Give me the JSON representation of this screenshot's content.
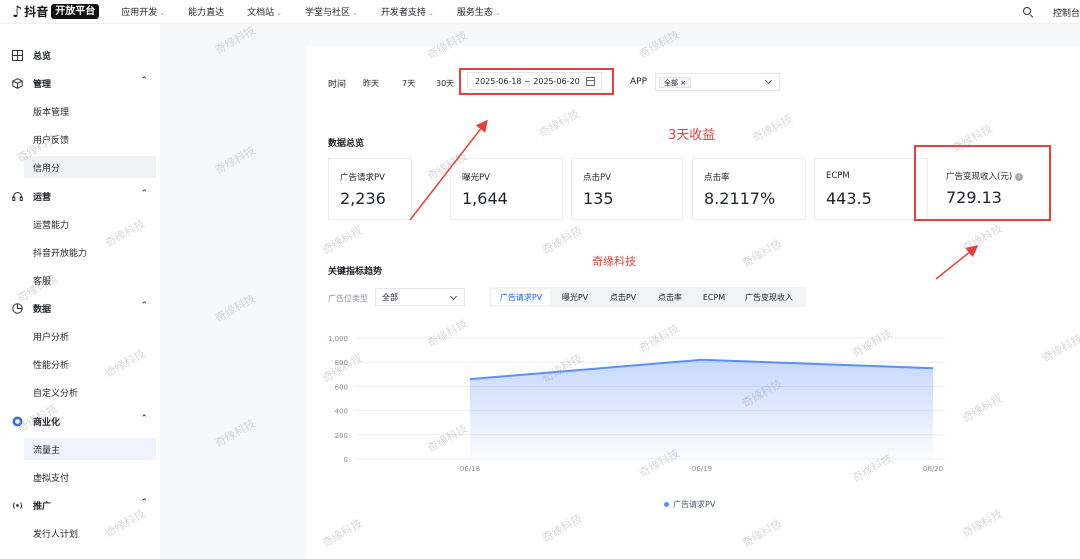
{
  "topnav": {
    "logo_brand": "抖音",
    "logo_badge": "开放平台",
    "menu": [
      "应用开发",
      "能力直达",
      "文档站",
      "学堂与社区",
      "开发者支持",
      "服务生态"
    ],
    "menu_has_caret": [
      true,
      false,
      true,
      true,
      true,
      true
    ],
    "console": "控制台"
  },
  "sidebar": {
    "overview": "总览",
    "groups": {
      "manage": "管理",
      "ops": "运营",
      "data": "数据",
      "biz": "商业化",
      "promo": "推广"
    },
    "items": {
      "version": "版本管理",
      "feedback": "用户反馈",
      "credit": "信用分",
      "ops_ability": "运营能力",
      "dy_ability": "抖音开放能力",
      "service": "客服",
      "user_analysis": "用户分析",
      "perf_analysis": "性能分析",
      "custom_analysis": "自定义分析",
      "traffic": "流量主",
      "vpay": "虚拟支付",
      "publisher": "发行人计划"
    }
  },
  "filters": {
    "time_label": "时间",
    "quick": [
      "昨天",
      "7天",
      "30天"
    ],
    "date_range": "2025-06-18 ~ 2025-06-20",
    "app_label": "APP",
    "app_tag": "全部 ×"
  },
  "overview": {
    "title": "数据总览",
    "metrics": [
      {
        "label": "广告请求PV",
        "value": "2,236"
      },
      {
        "label": "曝光PV",
        "value": "1,644"
      },
      {
        "label": "点击PV",
        "value": "135"
      },
      {
        "label": "点击率",
        "value": "8.2117%"
      },
      {
        "label": "ECPM",
        "value": "443.5"
      },
      {
        "label": "广告变现收入(元)",
        "value": "729.13"
      }
    ]
  },
  "annotations": {
    "three_day": "3天收益",
    "brand": "奇缘科技"
  },
  "trend": {
    "title": "关键指标趋势",
    "type_label": "广告位类型",
    "type_value": "全部",
    "tabs": [
      "广告请求PV",
      "曝光PV",
      "点击PV",
      "点击率",
      "ECPM",
      "广告变现收入"
    ],
    "active_tab": 0
  },
  "chart_data": {
    "type": "area",
    "x": [
      "06/18",
      "06/19",
      "06/20"
    ],
    "series": [
      {
        "name": "广告请求PV",
        "values": [
          660,
          820,
          750
        ]
      }
    ],
    "ylim": [
      0,
      1000
    ],
    "yticks": [
      "0",
      "200",
      "400",
      "600",
      "800",
      "1,000"
    ],
    "grid": true,
    "legend": "bottom",
    "color": "#5b8ff9"
  },
  "watermark": "奇缘科技",
  "colors": {
    "accent": "#1664ff",
    "annotation": "#e5413a",
    "series": "#5b8ff9"
  }
}
